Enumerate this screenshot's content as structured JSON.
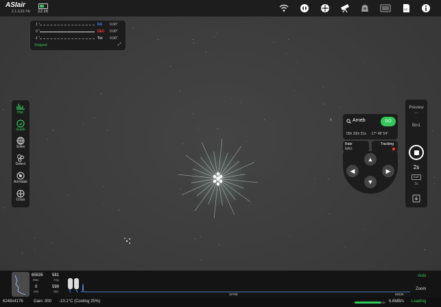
{
  "app": {
    "name": "ASIair",
    "version": "2.1.1(10.74)",
    "time": "22:16",
    "battery_level": 0.6
  },
  "top_icons": [
    "wifi-icon",
    "mode-icon",
    "mount-icon",
    "telescope-icon",
    "camera-icon",
    "storage-icon",
    "sd-card-icon",
    "info-icon"
  ],
  "guide": {
    "y_labels": [
      "1 \"",
      "0 \"",
      "-1 \""
    ],
    "ra_label": "RA",
    "ra_value": "0.00\"",
    "dec_label": "DEC",
    "dec_value": "0.00\"",
    "tot_label": "Tot",
    "tot_value": "0.00\"",
    "status": "Stopped",
    "colors": {
      "ra": "#3a8bff",
      "dec": "#ff3b3b",
      "status": "#34c85a"
    }
  },
  "left_tools": [
    {
      "label": "Hist.",
      "icon": "histogram-icon",
      "active": true
    },
    {
      "label": "Guide",
      "icon": "guide-icon",
      "active": true
    },
    {
      "label": "Solve",
      "icon": "plate-solve-icon",
      "active": false
    },
    {
      "label": "Detect",
      "icon": "detect-stars-icon",
      "active": false
    },
    {
      "label": "Annotate",
      "icon": "annotate-icon",
      "active": false
    },
    {
      "label": "Cross",
      "icon": "crosshair-icon",
      "active": false
    }
  ],
  "goto": {
    "target": "Arneb",
    "go_label": "GO",
    "ra": "05h 33m 51s",
    "dec": "-17° 48' 54\"",
    "rate_label": "Rate",
    "rate_value": "MAX",
    "tracking_label": "Tracking"
  },
  "right_panel": {
    "preview_label": "Preview",
    "bin_label": "Bin1",
    "exposure": "2s",
    "exp_badge": "EXP",
    "exp_value": "3s"
  },
  "histogram": {
    "max_value": "65535",
    "max_label": "Max",
    "avg_value": "581",
    "avg_label": "Avg",
    "min_value": "0",
    "min_label": "Min",
    "std_value": "599",
    "std_label": "Std",
    "axis_mid": "32768",
    "axis_max": "65535",
    "auto_label": "Auto",
    "zoom_label": "Zoom"
  },
  "status": {
    "resolution": "6248x4176",
    "gain": "Gain: 300",
    "temperature": "-10.1°C (Cooling 25%)",
    "speed": "6.6MB/s",
    "loading": "Loading",
    "progress": 0.85
  }
}
